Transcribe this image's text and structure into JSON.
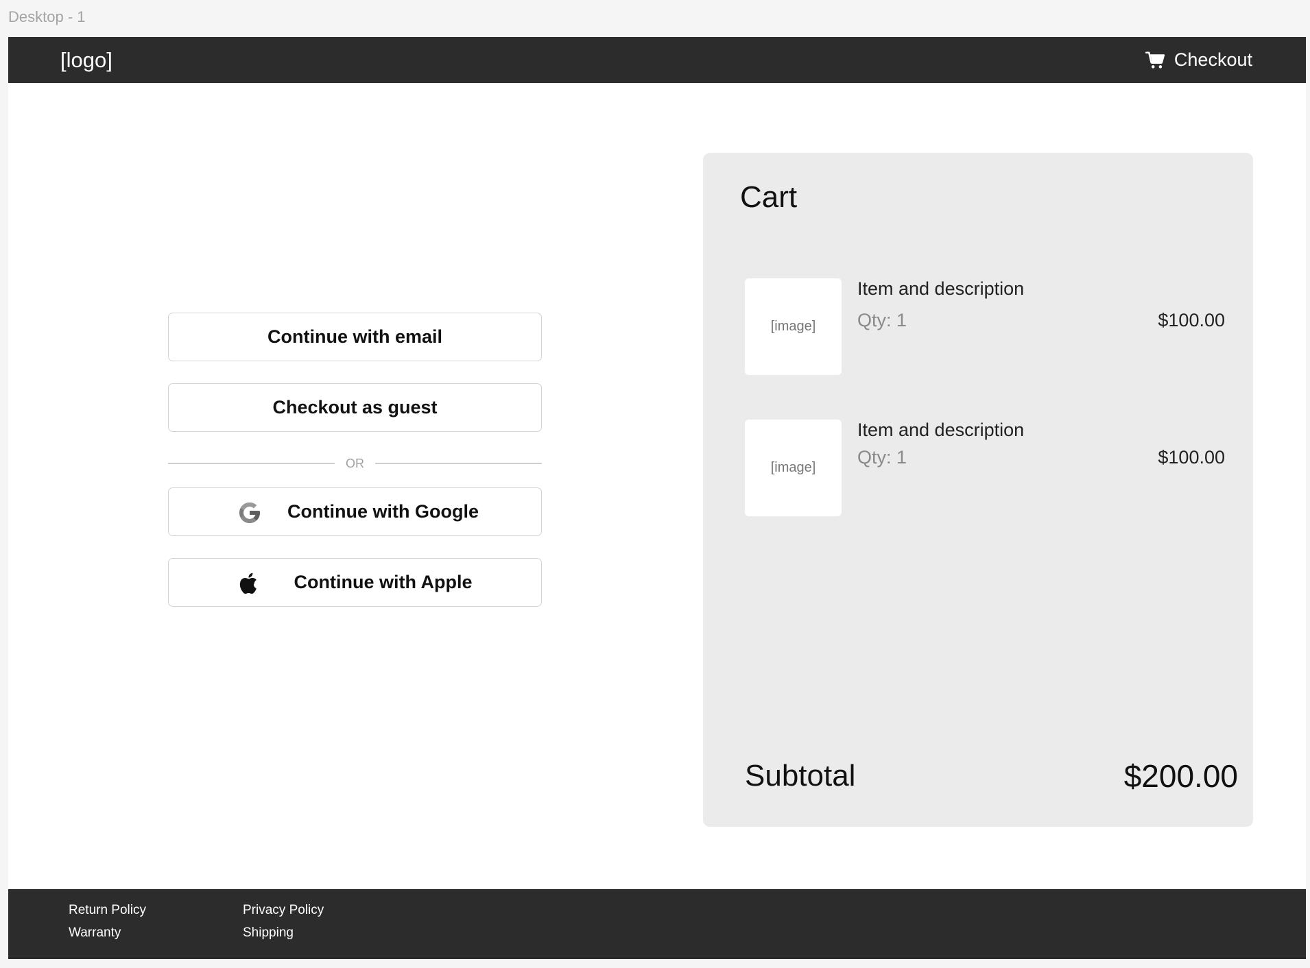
{
  "frame": {
    "label": "Desktop - 1"
  },
  "header": {
    "logo": "[logo]",
    "checkout_label": "Checkout",
    "checkout_icon": "cart-icon",
    "background": "#2c2c2c"
  },
  "auth": {
    "email_label": "Continue with email",
    "guest_label": "Checkout as guest",
    "divider_text": "OR",
    "google_label": "Continue with Google",
    "google_icon": "google-icon",
    "apple_label": "Continue with Apple",
    "apple_icon": "apple-icon"
  },
  "cart": {
    "title": "Cart",
    "items": [
      {
        "image_placeholder": "[image]",
        "title": "Item and description",
        "qty": "Qty: 1",
        "price": "$100.00"
      },
      {
        "image_placeholder": "[image]",
        "title": "Item and description",
        "qty": "Qty: 1",
        "price": "$100.00"
      }
    ],
    "subtotal_label": "Subtotal",
    "subtotal_value": "$200.00",
    "background": "#ebebeb"
  },
  "footer": {
    "links": [
      "Return Policy",
      "Warranty",
      "Privacy Policy",
      "Shipping"
    ],
    "background": "#2c2c2c"
  }
}
